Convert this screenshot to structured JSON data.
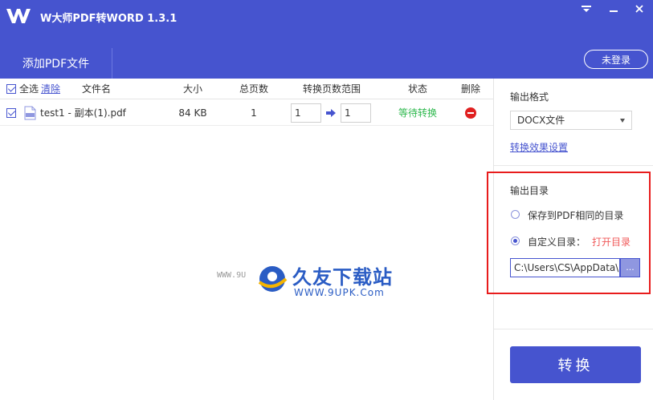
{
  "app": {
    "title": "W大师PDF转WORD 1.3.1"
  },
  "window_controls": {
    "menu_icon": "menu-icon",
    "minimize_icon": "minimize-icon",
    "close_icon": "close-icon"
  },
  "toolbar": {
    "add_pdf_label": "添加PDF文件",
    "login_label": "未登录"
  },
  "file_list": {
    "headers": {
      "select_all": "全选",
      "clear": "清除",
      "filename": "文件名",
      "size": "大小",
      "total_pages": "总页数",
      "page_range": "转换页数范围",
      "status": "状态",
      "delete": "删除"
    },
    "rows": [
      {
        "checked": true,
        "filename": "test1 - 副本(1).pdf",
        "size": "84 KB",
        "total_pages": "1",
        "range_start": "1",
        "range_end": "1",
        "status": "等待转换"
      }
    ]
  },
  "watermark": {
    "brand": "久友下载站",
    "url": "WWW.9UPK.Com",
    "prefix": "WWW.9U"
  },
  "settings": {
    "output_format_label": "输出格式",
    "output_format_value": "DOCX文件",
    "effect_settings_link": "转换效果设置",
    "output_dir_label": "输出目录",
    "option_same_dir": "保存到PDF相同的目录",
    "option_custom_dir": "自定义目录：",
    "open_dir_link": "打开目录",
    "custom_path": "C:\\Users\\CS\\AppData\\R",
    "browse_label": "...",
    "convert_label": "转换"
  },
  "colors": {
    "accent": "#4654cf",
    "status_waiting": "#2db84d",
    "highlight": "#e81c1c",
    "open_dir": "#f05a5a"
  }
}
